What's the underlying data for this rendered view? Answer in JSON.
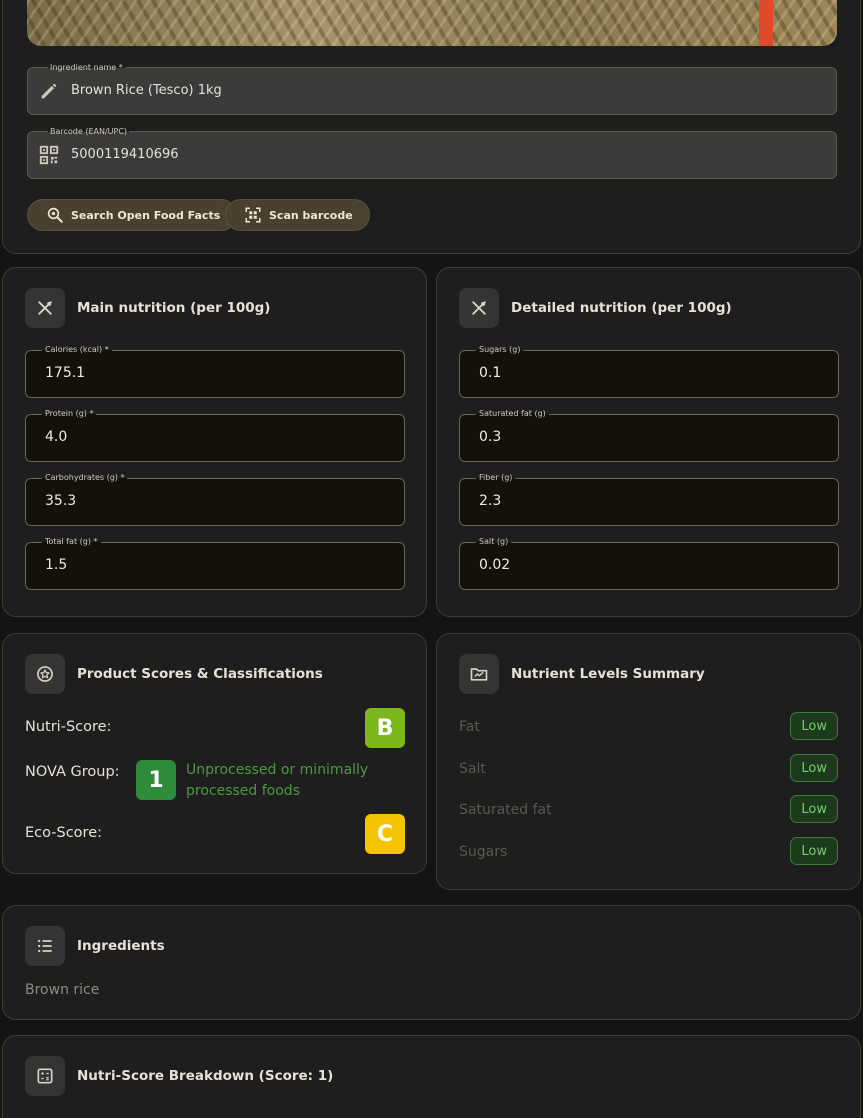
{
  "product": {
    "name_label": "Ingredient name *",
    "name_value": "Brown Rice (Tesco) 1kg",
    "barcode_label": "Barcode (EAN/UPC)",
    "barcode_value": "5000119410696",
    "search_button": "Search Open Food Facts",
    "scan_button": "Scan barcode"
  },
  "main_nutrition": {
    "title": "Main nutrition (per 100g)",
    "fields": [
      {
        "label": "Calories (kcal) *",
        "value": "175.1"
      },
      {
        "label": "Protein (g) *",
        "value": "4.0"
      },
      {
        "label": "Carbohydrates (g) *",
        "value": "35.3"
      },
      {
        "label": "Total fat (g) *",
        "value": "1.5"
      }
    ]
  },
  "detailed_nutrition": {
    "title": "Detailed nutrition (per 100g)",
    "fields": [
      {
        "label": "Sugars (g)",
        "value": "0.1"
      },
      {
        "label": "Saturated fat (g)",
        "value": "0.3"
      },
      {
        "label": "Fiber (g)",
        "value": "2.3"
      },
      {
        "label": "Salt (g)",
        "value": "0.02"
      }
    ]
  },
  "scores": {
    "title": "Product Scores & Classifications",
    "nutri_label": "Nutri-Score:",
    "nutri_grade": "B",
    "nova_label": "NOVA Group:",
    "nova_value": "1",
    "nova_desc": "Unprocessed or minimally processed foods",
    "eco_label": "Eco-Score:",
    "eco_grade": "C"
  },
  "levels": {
    "title": "Nutrient Levels Summary",
    "items": [
      {
        "name": "Fat",
        "level": "Low"
      },
      {
        "name": "Salt",
        "level": "Low"
      },
      {
        "name": "Saturated fat",
        "level": "Low"
      },
      {
        "name": "Sugars",
        "level": "Low"
      }
    ]
  },
  "ingredients": {
    "title": "Ingredients",
    "text": "Brown rice"
  },
  "breakdown": {
    "title": "Nutri-Score Breakdown (Score: 1)"
  },
  "colors": {
    "nutri_b": "#7cb71c",
    "nova_1": "#2e8b3a",
    "eco_c": "#f5c400",
    "accent_chip": "#4a4030"
  },
  "icons": {
    "name_field": "pencil-icon",
    "barcode_field": "qr-code-icon",
    "search_button": "search-food-icon",
    "scan_button": "barcode-scan-icon",
    "main_nutrition": "utensils-icon",
    "detailed_nutrition": "utensils-icon",
    "scores": "badge-icon",
    "levels": "chart-folder-icon",
    "ingredients": "list-icon",
    "breakdown": "calculator-icon"
  }
}
